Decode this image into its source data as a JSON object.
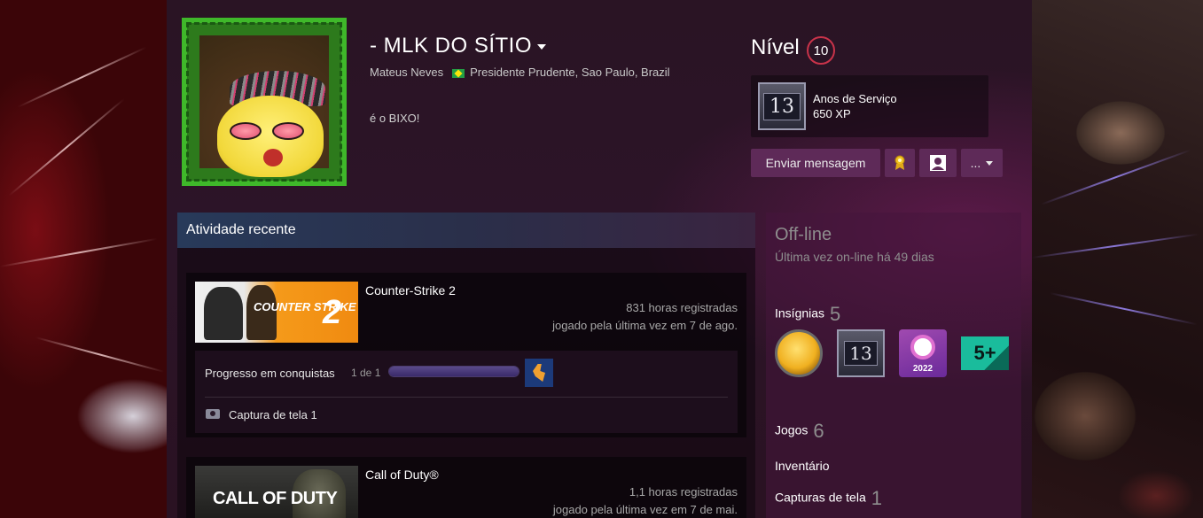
{
  "profile": {
    "persona_name": "- MLK DO SÍTIO",
    "real_name": "Mateus Neves",
    "location": "Presidente Prudente, Sao Paulo, Brazil",
    "summary": "é o BIXO!"
  },
  "level": {
    "label": "Nível",
    "value": "10"
  },
  "years_badge": {
    "number": "13",
    "title": "Anos de Serviço",
    "xp": "650 XP"
  },
  "actions": {
    "send_message": "Enviar mensagem",
    "more": "..."
  },
  "activity": {
    "header": "Atividade recente",
    "games": [
      {
        "name": "Counter-Strike 2",
        "capsule_logo": "COUNTER STRIKE",
        "capsule_number": "2",
        "hours": "831 horas registradas",
        "last_played": "jogado pela última vez em 7 de ago.",
        "achievements_label": "Progresso em conquistas",
        "achievements_count": "1 de 1",
        "achievements_progress": 1.0,
        "screenshots": "Captura de tela 1"
      },
      {
        "name": "Call of Duty®",
        "capsule_logo": "CALL OF DUTY",
        "hours": "1,1 horas registradas",
        "last_played": "jogado pela última vez em 7 de mai."
      }
    ]
  },
  "sidebar": {
    "status": "Off-line",
    "last_online": "Última vez on-line há 49 dias",
    "badges_label": "Insígnias",
    "badges_count": "5",
    "badge_items": [
      "gold-coin-badge",
      "years-of-service-badge",
      "steam-2022-badge",
      "five-plus-badge"
    ],
    "badge_13_number": "13",
    "badge_2022_year": "2022",
    "badge_5_text": "5+",
    "games_label": "Jogos",
    "games_count": "6",
    "inventory_label": "Inventário",
    "screenshots_label": "Capturas de tela",
    "screenshots_count": "1"
  },
  "colors": {
    "accent_button": "#5e2a58",
    "level_ring": "#c9334a",
    "header_gradient_start": "#283a5a"
  }
}
